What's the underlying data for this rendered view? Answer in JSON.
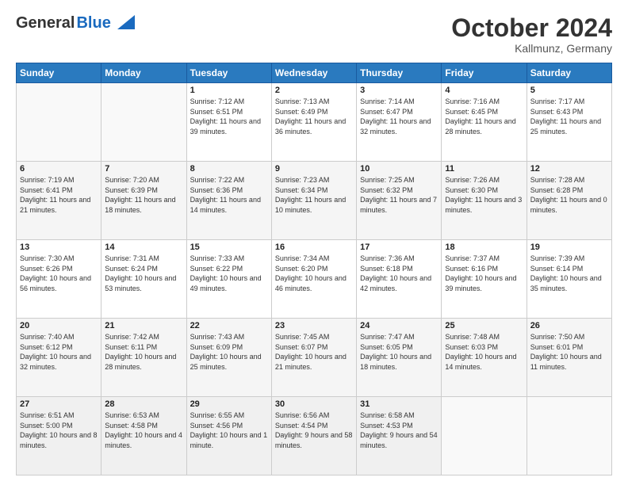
{
  "header": {
    "logo_general": "General",
    "logo_blue": "Blue",
    "month": "October 2024",
    "location": "Kallmunz, Germany"
  },
  "days_of_week": [
    "Sunday",
    "Monday",
    "Tuesday",
    "Wednesday",
    "Thursday",
    "Friday",
    "Saturday"
  ],
  "weeks": [
    [
      {
        "day": "",
        "info": ""
      },
      {
        "day": "",
        "info": ""
      },
      {
        "day": "1",
        "info": "Sunrise: 7:12 AM\nSunset: 6:51 PM\nDaylight: 11 hours and 39 minutes."
      },
      {
        "day": "2",
        "info": "Sunrise: 7:13 AM\nSunset: 6:49 PM\nDaylight: 11 hours and 36 minutes."
      },
      {
        "day": "3",
        "info": "Sunrise: 7:14 AM\nSunset: 6:47 PM\nDaylight: 11 hours and 32 minutes."
      },
      {
        "day": "4",
        "info": "Sunrise: 7:16 AM\nSunset: 6:45 PM\nDaylight: 11 hours and 28 minutes."
      },
      {
        "day": "5",
        "info": "Sunrise: 7:17 AM\nSunset: 6:43 PM\nDaylight: 11 hours and 25 minutes."
      }
    ],
    [
      {
        "day": "6",
        "info": "Sunrise: 7:19 AM\nSunset: 6:41 PM\nDaylight: 11 hours and 21 minutes."
      },
      {
        "day": "7",
        "info": "Sunrise: 7:20 AM\nSunset: 6:39 PM\nDaylight: 11 hours and 18 minutes."
      },
      {
        "day": "8",
        "info": "Sunrise: 7:22 AM\nSunset: 6:36 PM\nDaylight: 11 hours and 14 minutes."
      },
      {
        "day": "9",
        "info": "Sunrise: 7:23 AM\nSunset: 6:34 PM\nDaylight: 11 hours and 10 minutes."
      },
      {
        "day": "10",
        "info": "Sunrise: 7:25 AM\nSunset: 6:32 PM\nDaylight: 11 hours and 7 minutes."
      },
      {
        "day": "11",
        "info": "Sunrise: 7:26 AM\nSunset: 6:30 PM\nDaylight: 11 hours and 3 minutes."
      },
      {
        "day": "12",
        "info": "Sunrise: 7:28 AM\nSunset: 6:28 PM\nDaylight: 11 hours and 0 minutes."
      }
    ],
    [
      {
        "day": "13",
        "info": "Sunrise: 7:30 AM\nSunset: 6:26 PM\nDaylight: 10 hours and 56 minutes."
      },
      {
        "day": "14",
        "info": "Sunrise: 7:31 AM\nSunset: 6:24 PM\nDaylight: 10 hours and 53 minutes."
      },
      {
        "day": "15",
        "info": "Sunrise: 7:33 AM\nSunset: 6:22 PM\nDaylight: 10 hours and 49 minutes."
      },
      {
        "day": "16",
        "info": "Sunrise: 7:34 AM\nSunset: 6:20 PM\nDaylight: 10 hours and 46 minutes."
      },
      {
        "day": "17",
        "info": "Sunrise: 7:36 AM\nSunset: 6:18 PM\nDaylight: 10 hours and 42 minutes."
      },
      {
        "day": "18",
        "info": "Sunrise: 7:37 AM\nSunset: 6:16 PM\nDaylight: 10 hours and 39 minutes."
      },
      {
        "day": "19",
        "info": "Sunrise: 7:39 AM\nSunset: 6:14 PM\nDaylight: 10 hours and 35 minutes."
      }
    ],
    [
      {
        "day": "20",
        "info": "Sunrise: 7:40 AM\nSunset: 6:12 PM\nDaylight: 10 hours and 32 minutes."
      },
      {
        "day": "21",
        "info": "Sunrise: 7:42 AM\nSunset: 6:11 PM\nDaylight: 10 hours and 28 minutes."
      },
      {
        "day": "22",
        "info": "Sunrise: 7:43 AM\nSunset: 6:09 PM\nDaylight: 10 hours and 25 minutes."
      },
      {
        "day": "23",
        "info": "Sunrise: 7:45 AM\nSunset: 6:07 PM\nDaylight: 10 hours and 21 minutes."
      },
      {
        "day": "24",
        "info": "Sunrise: 7:47 AM\nSunset: 6:05 PM\nDaylight: 10 hours and 18 minutes."
      },
      {
        "day": "25",
        "info": "Sunrise: 7:48 AM\nSunset: 6:03 PM\nDaylight: 10 hours and 14 minutes."
      },
      {
        "day": "26",
        "info": "Sunrise: 7:50 AM\nSunset: 6:01 PM\nDaylight: 10 hours and 11 minutes."
      }
    ],
    [
      {
        "day": "27",
        "info": "Sunrise: 6:51 AM\nSunset: 5:00 PM\nDaylight: 10 hours and 8 minutes."
      },
      {
        "day": "28",
        "info": "Sunrise: 6:53 AM\nSunset: 4:58 PM\nDaylight: 10 hours and 4 minutes."
      },
      {
        "day": "29",
        "info": "Sunrise: 6:55 AM\nSunset: 4:56 PM\nDaylight: 10 hours and 1 minute."
      },
      {
        "day": "30",
        "info": "Sunrise: 6:56 AM\nSunset: 4:54 PM\nDaylight: 9 hours and 58 minutes."
      },
      {
        "day": "31",
        "info": "Sunrise: 6:58 AM\nSunset: 4:53 PM\nDaylight: 9 hours and 54 minutes."
      },
      {
        "day": "",
        "info": ""
      },
      {
        "day": "",
        "info": ""
      }
    ]
  ]
}
